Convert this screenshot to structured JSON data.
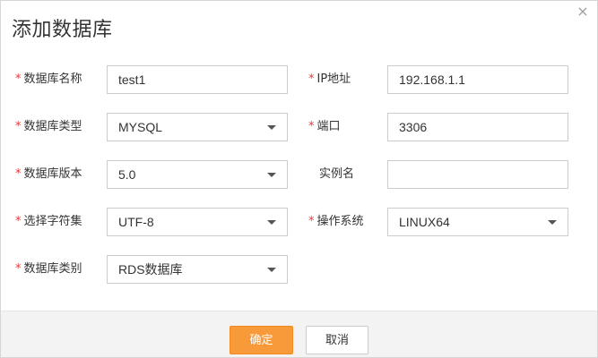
{
  "dialog": {
    "title": "添加数据库",
    "close_glyph": "×",
    "required_mark": "*"
  },
  "fields": {
    "db_name": {
      "label": "数据库名称",
      "value": "test1",
      "required": true
    },
    "ip": {
      "label": "IP地址",
      "value": "192.168.1.1",
      "required": true
    },
    "db_type": {
      "label": "数据库类型",
      "value": "MYSQL",
      "required": true
    },
    "port": {
      "label": "端口",
      "value": "3306",
      "required": true
    },
    "db_version": {
      "label": "数据库版本",
      "value": "5.0",
      "required": true
    },
    "instance": {
      "label": "实例名",
      "value": "",
      "required": false
    },
    "charset": {
      "label": "选择字符集",
      "value": "UTF-8",
      "required": true
    },
    "os": {
      "label": "操作系统",
      "value": "LINUX64",
      "required": true
    },
    "db_category": {
      "label": "数据库类别",
      "value": "RDS数据库",
      "required": true
    }
  },
  "footer": {
    "ok_label": "确定",
    "cancel_label": "取消"
  },
  "colors": {
    "accent": "#f89a3a",
    "required": "#e4393c",
    "footer_bg": "#f3f3f3"
  },
  "icons": {
    "close": "close-icon",
    "dropdown": "chevron-down-icon"
  }
}
